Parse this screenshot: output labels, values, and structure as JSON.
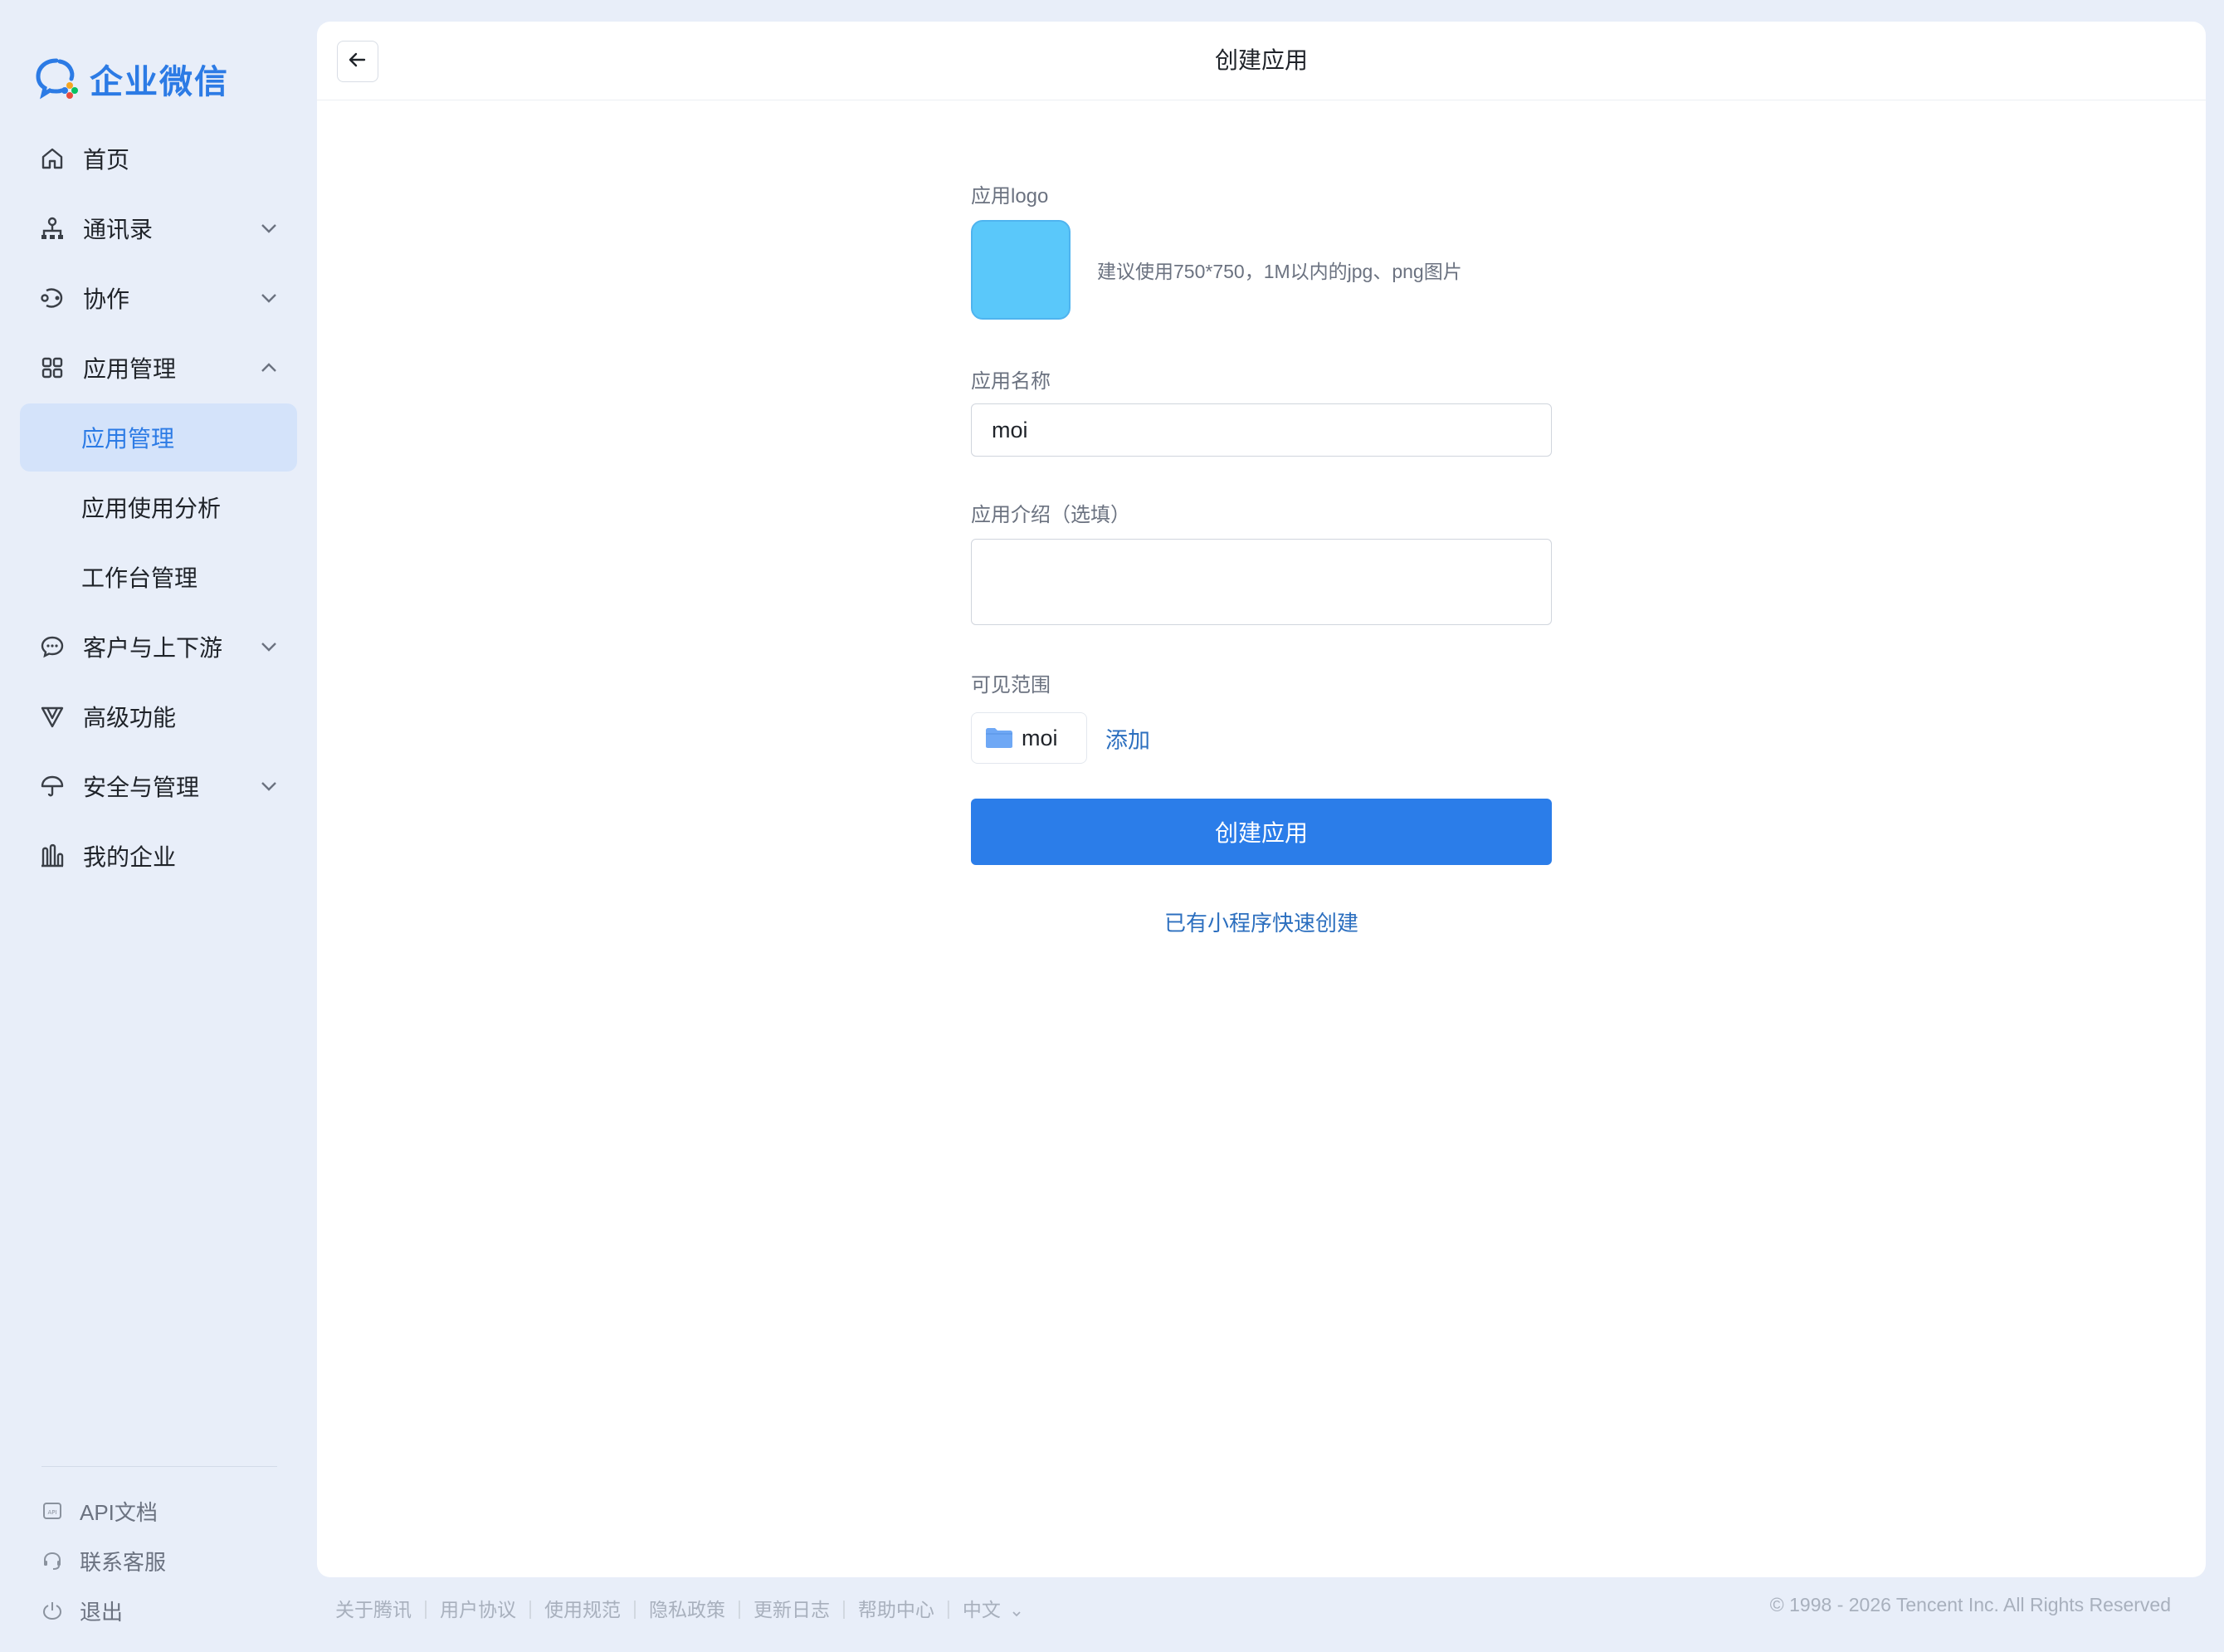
{
  "brand": {
    "name": "企业微信"
  },
  "sidebar": {
    "items": [
      {
        "label": "首页",
        "icon": "home-icon"
      },
      {
        "label": "通讯录",
        "icon": "org-chart-icon"
      },
      {
        "label": "协作",
        "icon": "collaboration-icon"
      },
      {
        "label": "应用管理",
        "icon": "apps-grid-icon"
      },
      {
        "label": "应用管理"
      },
      {
        "label": "应用使用分析"
      },
      {
        "label": "工作台管理"
      },
      {
        "label": "客户与上下游",
        "icon": "chat-bubble-icon"
      },
      {
        "label": "高级功能",
        "icon": "advanced-icon"
      },
      {
        "label": "安全与管理",
        "icon": "umbrella-icon"
      },
      {
        "label": "我的企业",
        "icon": "building-icon"
      }
    ],
    "bottom": [
      {
        "label": "API文档",
        "icon": "api-doc-icon"
      },
      {
        "label": "联系客服",
        "icon": "headset-icon"
      },
      {
        "label": "退出",
        "icon": "power-icon"
      }
    ]
  },
  "header": {
    "title": "创建应用",
    "back_icon": "arrow-left-icon"
  },
  "form": {
    "logo_label": "应用logo",
    "logo_color": "#5ac8fa",
    "logo_hint": "建议使用750*750，1M以内的jpg、png图片",
    "name_label": "应用名称",
    "name_value": "moi",
    "intro_label": "应用介绍（选填）",
    "intro_value": "",
    "scope_label": "可见范围",
    "scope_chip": "moi",
    "scope_add": "添加",
    "submit_label": "创建应用",
    "mini_program_link": "已有小程序快速创建"
  },
  "footer": {
    "links": [
      "关于腾讯",
      "用户协议",
      "使用规范",
      "隐私政策",
      "更新日志",
      "帮助中心"
    ],
    "language": "中文",
    "copyright": "© 1998 - 2026 Tencent Inc. All Rights Reserved"
  },
  "colors": {
    "accent": "#2b7de9",
    "active_bg": "#d4e3fa",
    "page_bg": "#e8eef9"
  }
}
